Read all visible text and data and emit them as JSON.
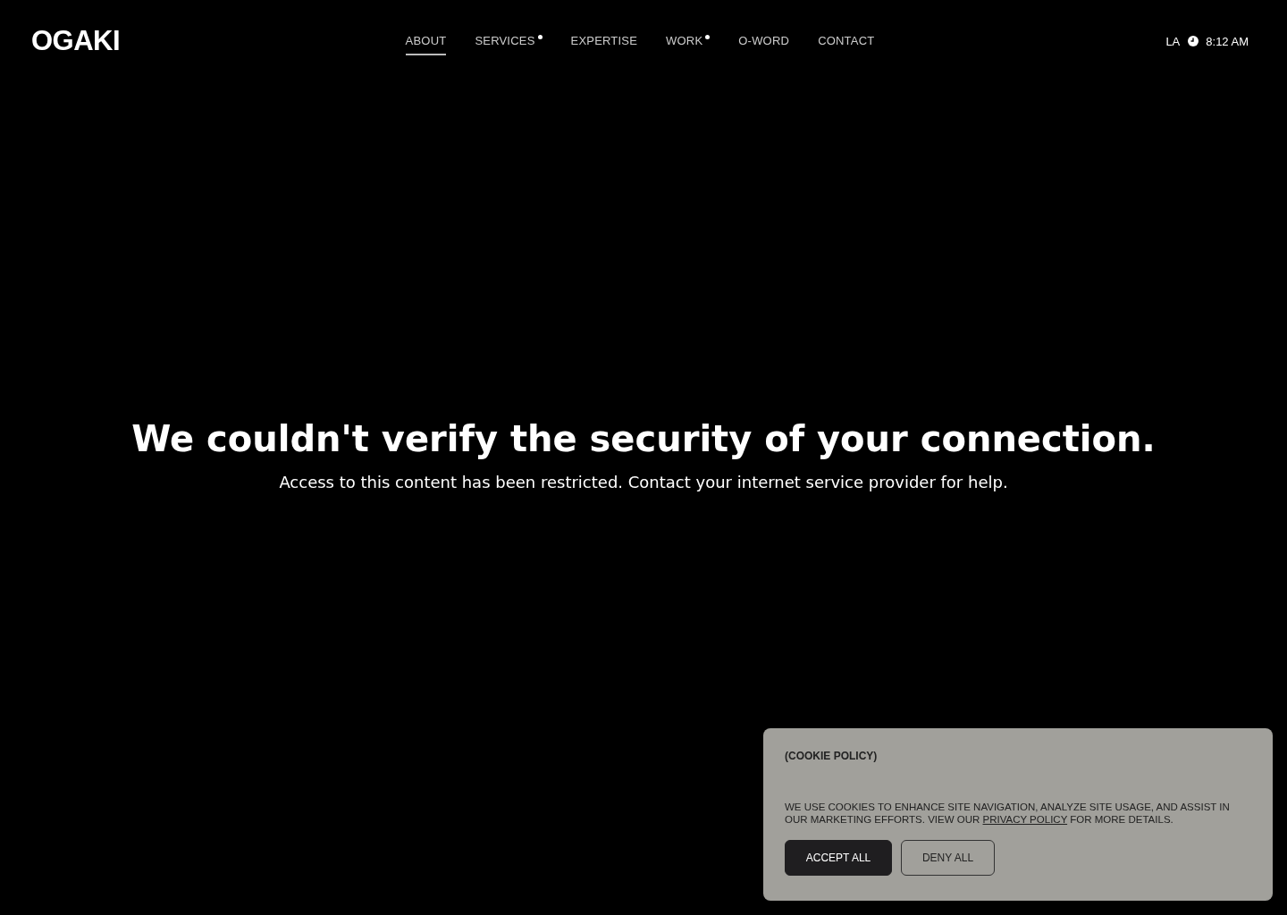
{
  "header": {
    "logo": "OGAKI",
    "nav": [
      {
        "label": "ABOUT",
        "selected": true,
        "dot": false
      },
      {
        "label": "SERVICES",
        "selected": false,
        "dot": true
      },
      {
        "label": "EXPERTISE",
        "selected": false,
        "dot": false
      },
      {
        "label": "WORK",
        "selected": false,
        "dot": true
      },
      {
        "label": "O-WORD",
        "selected": false,
        "dot": false
      },
      {
        "label": "CONTACT",
        "selected": false,
        "dot": false
      }
    ],
    "city": "LA",
    "time": "8:12 AM"
  },
  "message": {
    "title": "We couldn't verify the security of your connection.",
    "subtitle": "Access to this content has been restricted. Contact your internet service provider for help."
  },
  "cookie_banner": {
    "title": "(COOKIE POLICY)",
    "text_before": "WE USE COOKIES TO ENHANCE SITE NAVIGATION, ANALYZE SITE USAGE, AND ASSIST IN OUR MARKETING EFFORTS. VIEW OUR",
    "link": "PRIVACY POLICY",
    "text_after": "FOR MORE DETAILS.",
    "buttons": [
      {
        "label": "ACCEPT ALL",
        "kind": "primary"
      },
      {
        "label": "DENY ALL",
        "kind": "outline"
      }
    ]
  }
}
